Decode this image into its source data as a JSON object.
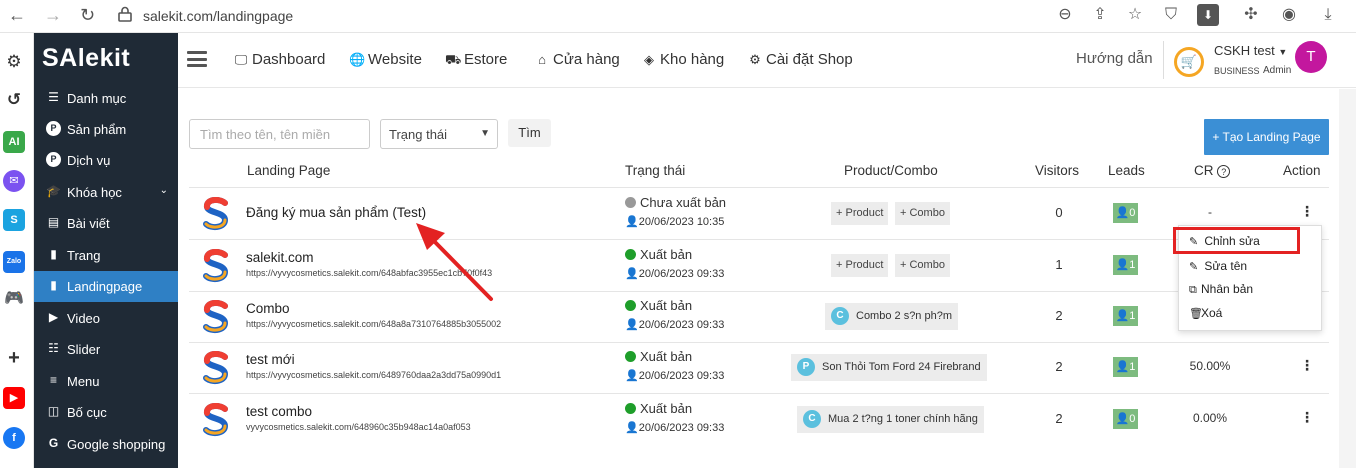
{
  "browser": {
    "url": "salekit.com/landingpage"
  },
  "app": {
    "logo": "SAlekit",
    "sidebar": [
      {
        "label": "Danh mục",
        "icon": "list-icon"
      },
      {
        "label": "Sản phẩm",
        "icon": "product-icon"
      },
      {
        "label": "Dịch vụ",
        "icon": "service-icon"
      },
      {
        "label": "Khóa học",
        "icon": "graduation-icon"
      },
      {
        "label": "Bài viết",
        "icon": "article-icon"
      },
      {
        "label": "Trang",
        "icon": "page-icon"
      },
      {
        "label": "Landingpage",
        "icon": "file-icon"
      },
      {
        "label": "Video",
        "icon": "video-icon"
      },
      {
        "label": "Slider",
        "icon": "slider-icon"
      },
      {
        "label": "Menu",
        "icon": "menu-icon"
      },
      {
        "label": "Bố cục",
        "icon": "layout-icon"
      },
      {
        "label": "Google shopping",
        "icon": "google-icon"
      }
    ]
  },
  "topnav": {
    "items": [
      {
        "label": "Dashboard",
        "icon": "monitor-icon"
      },
      {
        "label": "Website",
        "icon": "globe-icon"
      },
      {
        "label": "Estore",
        "icon": "store-icon"
      },
      {
        "label": "Cửa hàng",
        "icon": "shop-icon"
      },
      {
        "label": "Kho hàng",
        "icon": "layers-icon"
      },
      {
        "label": "Cài đặt Shop",
        "icon": "gear-icon"
      }
    ],
    "help": "Hướng dẫn",
    "user": {
      "name": "CSKH test",
      "plan": "BUSINESS",
      "role": "Admin",
      "initial": "T"
    }
  },
  "filters": {
    "search_placeholder": "Tìm theo tên, tên miền",
    "status_label": "Trạng thái",
    "find_label": "Tìm",
    "create_label": "+ Tạo Landing Page"
  },
  "table": {
    "headers": {
      "landing": "Landing Page",
      "status": "Trạng thái",
      "product": "Product/Combo",
      "visitors": "Visitors",
      "leads": "Leads",
      "cr": "CR",
      "action": "Action"
    },
    "rows": [
      {
        "title": "Đăng ký mua sản phẩm (Test)",
        "url": "",
        "status": "Chưa xuất bản",
        "status_color": "#999999",
        "date": "20/06/2023 10:35",
        "product": {
          "type": "buttons",
          "product_label": "+ Product",
          "combo_label": "+ Combo"
        },
        "visitors": "0",
        "leads": "0",
        "cr": "-"
      },
      {
        "title": "salekit.com",
        "url": "https://vyvycosmetics.salekit.com/648abfac3955ec1cb70f0f43",
        "status": "Xuất bản",
        "status_color": "#1e9e2a",
        "date": "20/06/2023 09:33",
        "product": {
          "type": "buttons",
          "product_label": "+ Product",
          "combo_label": "+ Combo"
        },
        "visitors": "1",
        "leads": "1",
        "cr": ""
      },
      {
        "title": "Combo",
        "url": "https://vyvycosmetics.salekit.com/648a8a7310764885b3055002",
        "status": "Xuất bản",
        "status_color": "#1e9e2a",
        "date": "20/06/2023 09:33",
        "product": {
          "type": "tag",
          "letter": "C",
          "label": "Combo 2 s?n ph?m"
        },
        "visitors": "2",
        "leads": "1",
        "cr": ""
      },
      {
        "title": "test mới",
        "url": "https://vyvycosmetics.salekit.com/6489760daa2a3dd75a0990d1",
        "status": "Xuất bản",
        "status_color": "#1e9e2a",
        "date": "20/06/2023 09:33",
        "product": {
          "type": "tag",
          "letter": "P",
          "label": "Son Thỏi Tom Ford 24 Firebrand"
        },
        "visitors": "2",
        "leads": "1",
        "cr": "50.00%"
      },
      {
        "title": "test combo",
        "url": "vyvycosmetics.salekit.com/648960c35b948ac14a0af053",
        "status": "Xuất bản",
        "status_color": "#1e9e2a",
        "date": "20/06/2023 09:33",
        "product": {
          "type": "tag",
          "letter": "C",
          "label": "Mua 2 t?ng 1 toner chính hãng"
        },
        "visitors": "2",
        "leads": "0",
        "cr": "0.00%"
      }
    ]
  },
  "action_menu": {
    "items": [
      {
        "label": "Chỉnh sửa",
        "icon": "edit-icon"
      },
      {
        "label": "Sửa tên",
        "icon": "rename-icon"
      },
      {
        "label": "Nhân bản",
        "icon": "copy-icon"
      },
      {
        "label": "Xoá",
        "icon": "trash-icon"
      }
    ]
  },
  "colors": {
    "sidebar_bg": "#1f2a36",
    "sidebar_active": "#2f80c5",
    "primary": "#3b8fd5",
    "lead_badge": "#7dbb7f",
    "highlight": "#e32222"
  }
}
